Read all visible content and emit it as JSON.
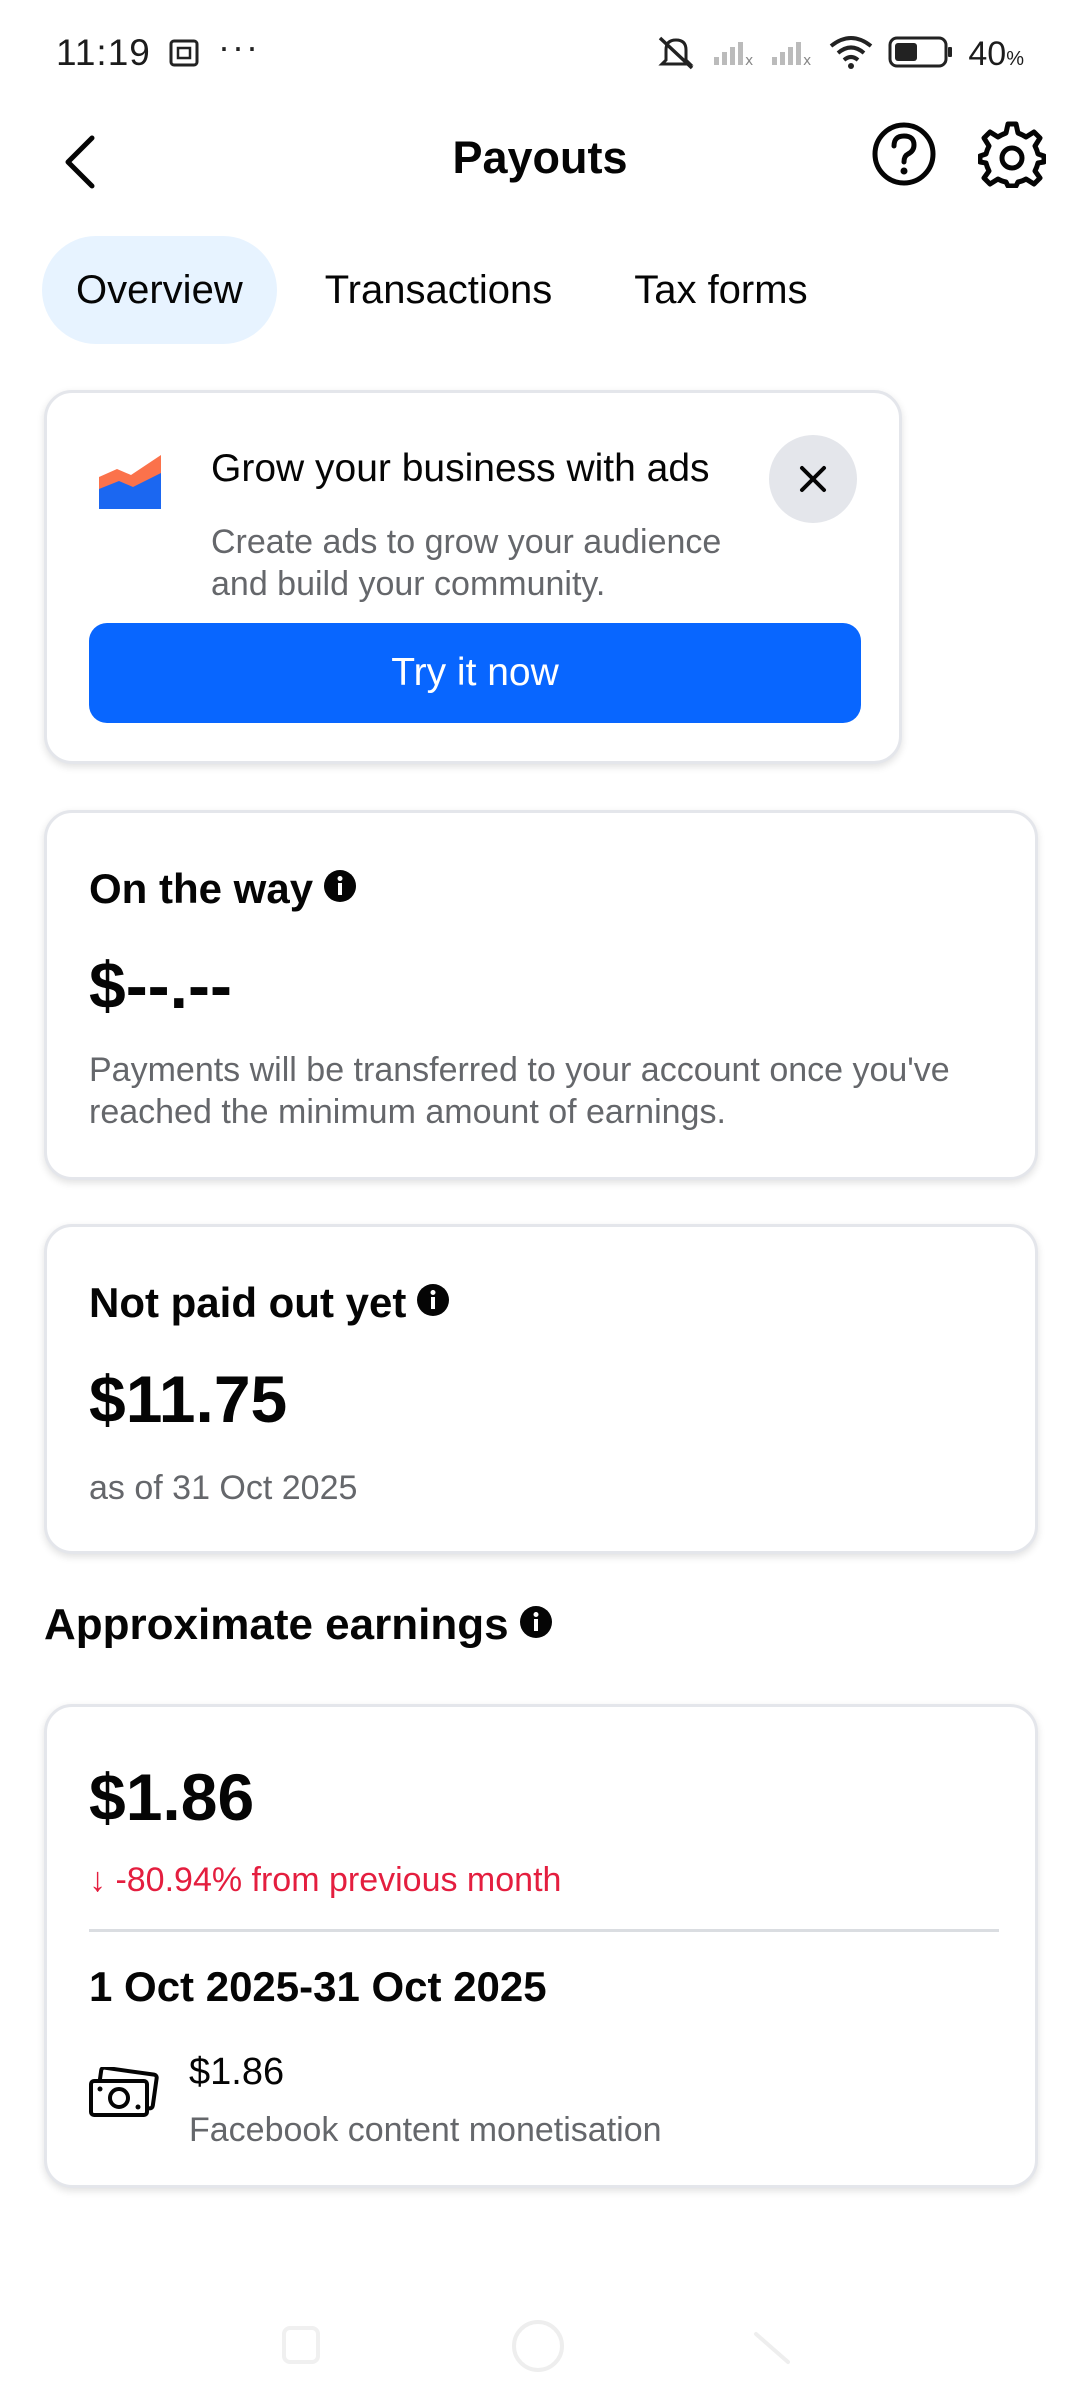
{
  "status_bar": {
    "time": "11:19",
    "battery": "40",
    "battery_unit": "%"
  },
  "header": {
    "title": "Payouts",
    "icons": [
      "back-arrow-icon",
      "help-icon",
      "settings-icon"
    ]
  },
  "tabs": [
    {
      "label": "Overview",
      "active": true
    },
    {
      "label": "Transactions",
      "active": false
    },
    {
      "label": "Tax forms",
      "active": false
    }
  ],
  "ad_card": {
    "title": "Grow your business with ads",
    "description": "Create ads to grow your audience and build your community.",
    "cta": "Try it now"
  },
  "on_the_way": {
    "title": "On the way",
    "amount": "$--.--",
    "description": "Payments will be transferred to your account once you've reached the minimum amount of earnings."
  },
  "not_paid": {
    "title": "Not paid out yet",
    "amount": "$11.75",
    "as_of": "as of 31 Oct 2025"
  },
  "approx": {
    "section_title": "Approximate earnings",
    "amount": "$1.86",
    "change": "↓ -80.94% from previous month",
    "period": "1 Oct 2025-31 Oct 2025",
    "source_amount": "$1.86",
    "source_label": "Facebook content monetisation"
  },
  "colors": {
    "accent": "#0866ff",
    "tab_active_bg": "#e7f3ff",
    "negative": "#e41e3f",
    "muted_text": "#65676b"
  }
}
